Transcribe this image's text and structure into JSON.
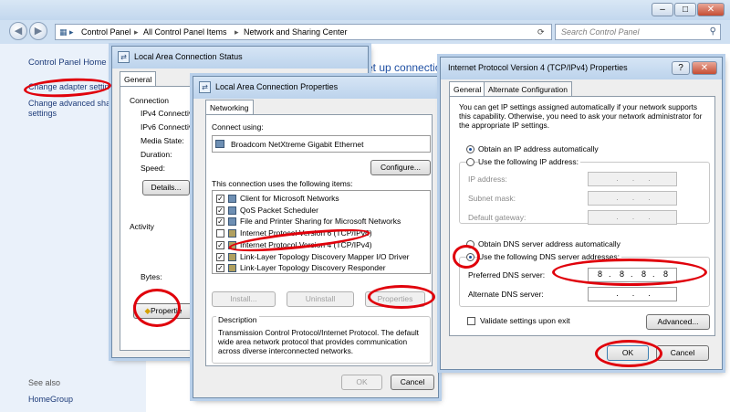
{
  "main_window": {
    "address_segments": [
      "Control Panel",
      "All Control Panel Items",
      "Network and Sharing Center"
    ],
    "search_placeholder": "Search Control Panel",
    "left_pane": {
      "home": "Control Panel Home",
      "links": [
        "Change adapter settings",
        "Change advanced shar",
        "settings"
      ],
      "see_also_header": "See also",
      "see_also": [
        "HomeGroup"
      ]
    },
    "content_link_partial": "et up connectio"
  },
  "status_dialog": {
    "title": "Local Area Connection Status",
    "tab": "General",
    "connection_header": "Connection",
    "rows": [
      "IPv4 Connectivi",
      "IPv6 Connectivi",
      "Media State:",
      "Duration:",
      "Speed:"
    ],
    "details_button": "Details...",
    "activity_header": "Activity",
    "bytes_label": "Bytes:",
    "properties_button": "Propertie"
  },
  "props_dialog": {
    "title": "Local Area Connection Properties",
    "tab": "Networking",
    "connect_using_label": "Connect using:",
    "adapter": "Broadcom NetXtreme Gigabit Ethernet",
    "configure_button": "Configure...",
    "items_label": "This connection uses the following items:",
    "items": [
      {
        "label": "Client for Microsoft Networks",
        "checked": true
      },
      {
        "label": "QoS Packet Scheduler",
        "checked": true
      },
      {
        "label": "File and Printer Sharing for Microsoft Networks",
        "checked": true
      },
      {
        "label": "Internet Protocol Version 6 (TCP/IPv6)",
        "checked": false
      },
      {
        "label": "Internet Protocol Version 4 (TCP/IPv4)",
        "checked": true
      },
      {
        "label": "Link-Layer Topology Discovery Mapper I/O Driver",
        "checked": true
      },
      {
        "label": "Link-Layer Topology Discovery Responder",
        "checked": true
      }
    ],
    "install_button": "Install...",
    "uninstall_button": "Uninstall",
    "properties_button": "Properties",
    "description_header": "Description",
    "description_text": "Transmission Control Protocol/Internet Protocol. The default wide area network protocol that provides communication across diverse interconnected networks.",
    "ok_button": "OK",
    "cancel_button": "Cancel"
  },
  "ipv4_dialog": {
    "title": "Internet Protocol Version 4 (TCP/IPv4) Properties",
    "tabs": [
      "General",
      "Alternate Configuration"
    ],
    "intro": "You can get IP settings assigned automatically if your network supports this capability. Otherwise, you need to ask your network administrator for the appropriate IP settings.",
    "obtain_ip_auto": "Obtain an IP address automatically",
    "use_following_ip": "Use the following IP address:",
    "ip_address_label": "IP address:",
    "subnet_mask_label": "Subnet mask:",
    "default_gateway_label": "Default gateway:",
    "obtain_dns_auto": "Obtain DNS server address automatically",
    "use_following_dns": "Use the following DNS server addresses:",
    "preferred_dns_label": "Preferred DNS server:",
    "preferred_dns_octets": [
      "8",
      "8",
      "8",
      "8"
    ],
    "alternate_dns_label": "Alternate DNS server:",
    "validate_label": "Validate settings upon exit",
    "advanced_button": "Advanced...",
    "ok_button": "OK",
    "cancel_button": "Cancel",
    "help_glyph": "?",
    "close_glyph": "✕"
  },
  "colors": {
    "annotation_red": "#e0000b",
    "link_blue": "#1d3b79",
    "title_gradient": "#bcd3ec"
  }
}
